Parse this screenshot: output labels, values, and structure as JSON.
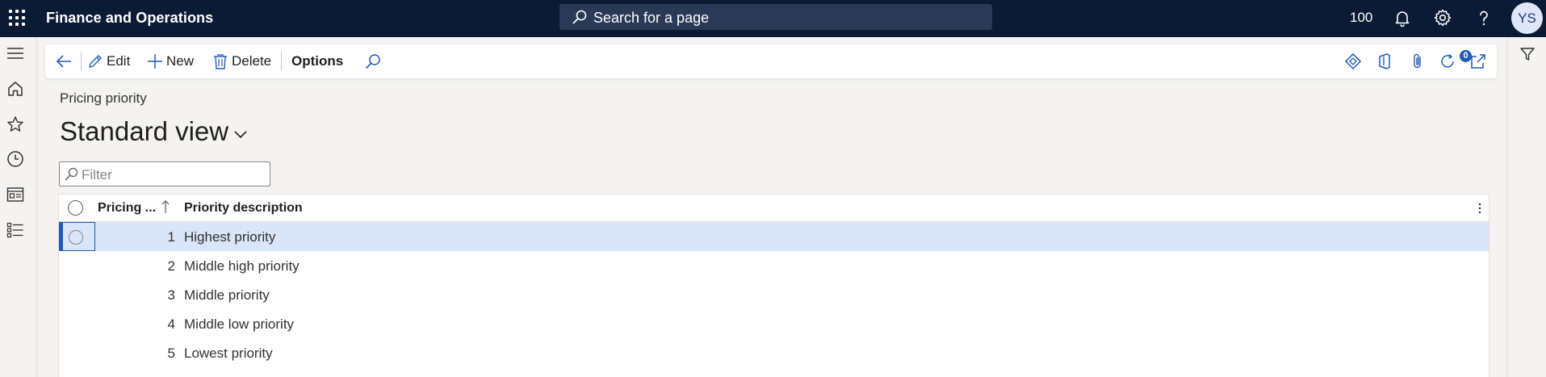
{
  "app": {
    "title": "Finance and Operations"
  },
  "search": {
    "placeholder": "Search for a page"
  },
  "topbar": {
    "company": "100",
    "avatar_initials": "YS"
  },
  "actions": {
    "edit": "Edit",
    "new": "New",
    "delete": "Delete",
    "options": "Options",
    "attachments_count": "0"
  },
  "page": {
    "caption": "Pricing priority",
    "view_title": "Standard view",
    "filter_placeholder": "Filter"
  },
  "grid": {
    "columns": {
      "pricing": "Pricing ...",
      "description": "Priority description"
    },
    "rows": [
      {
        "num": "1",
        "desc": "Highest priority"
      },
      {
        "num": "2",
        "desc": "Middle high priority"
      },
      {
        "num": "3",
        "desc": "Middle priority"
      },
      {
        "num": "4",
        "desc": "Middle low priority"
      },
      {
        "num": "5",
        "desc": "Lowest priority"
      }
    ]
  },
  "colors": {
    "topbar": "#0b1b36",
    "accent": "#1f5bb5",
    "selected_row": "#d9e5f8"
  }
}
